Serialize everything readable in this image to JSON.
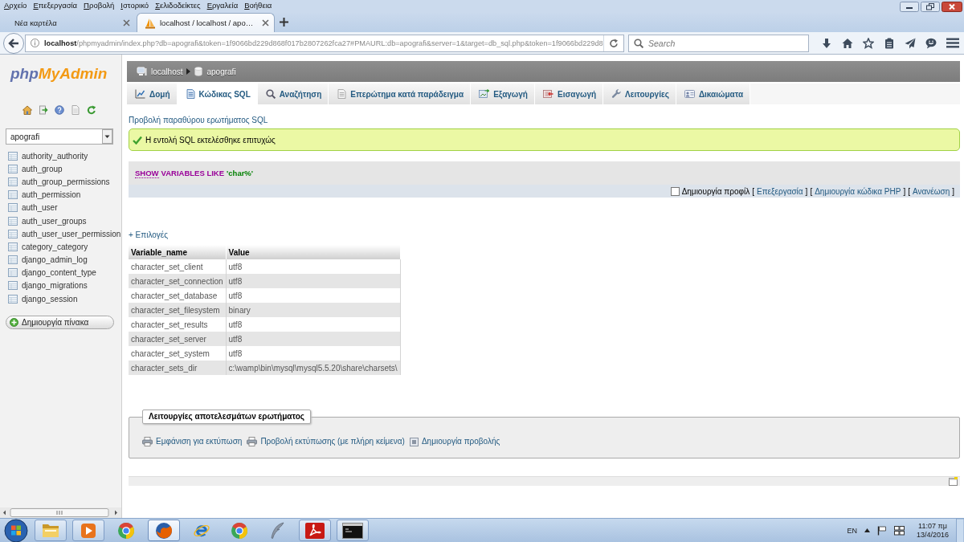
{
  "browser": {
    "menu": [
      "Αρχείο",
      "Επεξεργασία",
      "Προβολή",
      "Ιστορικό",
      "Σελιδοδείκτες",
      "Εργαλεία",
      "Βοήθεια"
    ],
    "tabs": [
      {
        "kind": "new",
        "title": "Νέα καρτέλα",
        "selected": false
      },
      {
        "kind": "page",
        "title": "localhost / localhost / apo…",
        "selected": true
      }
    ],
    "address": {
      "host": "localhost",
      "path": "/phpmyadmin/index.php?db=apografi&token=1f9066bd229d868f017b2807262fca27#PMAURL:db=apografi&server=1&target=db_sql.php&token=1f9066bd229d8"
    },
    "search": {
      "placeholder": "Search"
    }
  },
  "sidebar": {
    "logo": [
      "php",
      "MyAdmin"
    ],
    "database": "apografi",
    "tables": [
      "authority_authority",
      "auth_group",
      "auth_group_permissions",
      "auth_permission",
      "auth_user",
      "auth_user_groups",
      "auth_user_user_permission",
      "category_category",
      "django_admin_log",
      "django_content_type",
      "django_migrations",
      "django_session"
    ],
    "create_table": "Δημιουργία πίνακα"
  },
  "main": {
    "breadcrumb": [
      "localhost",
      "apografi"
    ],
    "tabs": [
      {
        "kind": "structure",
        "label": "Δομή",
        "selected": false
      },
      {
        "kind": "sql",
        "label": "Κώδικας SQL",
        "selected": true
      },
      {
        "kind": "search",
        "label": "Αναζήτηση",
        "selected": false
      },
      {
        "kind": "query",
        "label": "Επερώτημα κατά παράδειγμα",
        "selected": false
      },
      {
        "kind": "export",
        "label": "Εξαγωγή",
        "selected": false
      },
      {
        "kind": "import",
        "label": "Εισαγωγή",
        "selected": false
      },
      {
        "kind": "operations",
        "label": "Λειτουργίες",
        "selected": false
      },
      {
        "kind": "privileges",
        "label": "Δικαιώματα",
        "selected": false
      }
    ],
    "query_window_link": "Προβολή παραθύρου ερωτήματος SQL",
    "message": "Η εντολή SQL εκτελέσθηκε επιτυχώς",
    "sql": [
      {
        "kind": "link",
        "text": "SHOW"
      },
      {
        "kind": "keyword",
        "text": "VARIABLES LIKE"
      },
      {
        "kind": "string",
        "text": "'char%'"
      }
    ],
    "profiling": {
      "label": "Δημιουργία προφίλ",
      "checked": false
    },
    "sql_links": [
      "Επεξεργασία",
      "Δημιουργία κώδικα PHP",
      "Ανανέωση"
    ],
    "brackets": [
      "[",
      "]"
    ],
    "options_link": "+ Επιλογές",
    "results": {
      "columns": [
        "Variable_name",
        "Value"
      ],
      "rows": [
        [
          "character_set_client",
          "utf8"
        ],
        [
          "character_set_connection",
          "utf8"
        ],
        [
          "character_set_database",
          "utf8"
        ],
        [
          "character_set_filesystem",
          "binary"
        ],
        [
          "character_set_results",
          "utf8"
        ],
        [
          "character_set_server",
          "utf8"
        ],
        [
          "character_set_system",
          "utf8"
        ],
        [
          "character_sets_dir",
          "c:\\wamp\\bin\\mysql\\mysql5.5.20\\share\\charsets\\"
        ]
      ]
    },
    "query_operations": {
      "legend": "Λειτουργίες αποτελεσμάτων ερωτήματος",
      "links": [
        {
          "kind": "print",
          "text": "Εμφάνιση για εκτύπωση"
        },
        {
          "kind": "print",
          "text": "Προβολή εκτύπωσης (με πλήρη κείμενα)"
        },
        {
          "kind": "view",
          "text": "Δημιουργία προβολής"
        }
      ]
    }
  },
  "taskbar": {
    "apps": [
      {
        "kind": "folder",
        "running": true,
        "selected": false
      },
      {
        "kind": "media",
        "running": true,
        "selected": false
      },
      {
        "kind": "chrome",
        "running": false,
        "selected": false
      },
      {
        "kind": "firefox",
        "running": true,
        "selected": true
      },
      {
        "kind": "ie",
        "running": false,
        "selected": false
      },
      {
        "kind": "chrome",
        "running": false,
        "selected": false
      },
      {
        "kind": "quill",
        "running": false,
        "selected": false
      },
      {
        "kind": "pdf",
        "running": true,
        "selected": false
      },
      {
        "kind": "console",
        "running": true,
        "selected": false
      }
    ],
    "language": "EN",
    "time": "11:07 πμ",
    "date": "13/4/2016"
  }
}
